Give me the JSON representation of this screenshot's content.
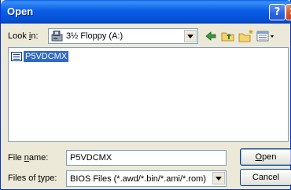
{
  "window": {
    "title": "Open"
  },
  "titlebar": {
    "help_glyph": "?",
    "close_glyph": "✕"
  },
  "lookin": {
    "label_pre": "Look ",
    "label_u": "i",
    "label_post": "n:",
    "value": "3½ Floppy (A:)"
  },
  "toolbar": {
    "icons": [
      "back-arrow-icon",
      "up-folder-icon",
      "new-folder-icon",
      "view-menu-icon"
    ]
  },
  "filelist": {
    "items": [
      {
        "name": "P5VDCMX",
        "selected": true,
        "icon": "file-icon"
      }
    ]
  },
  "filename": {
    "label_pre": "File ",
    "label_u": "n",
    "label_post": "ame:",
    "value": "P5VDCMX"
  },
  "filetype": {
    "label_pre": "Files of ",
    "label_u": "t",
    "label_post": "ype:",
    "value": "BIOS Files (*.awd/*.bin/*.ami/*.rom)"
  },
  "buttons": {
    "open_u": "O",
    "open_rest": "pen",
    "cancel": "Cancel"
  },
  "colors": {
    "titlebar": "#0a5fe8",
    "selection": "#316ac5",
    "face": "#ece9d8",
    "field_border": "#7f9db9"
  }
}
